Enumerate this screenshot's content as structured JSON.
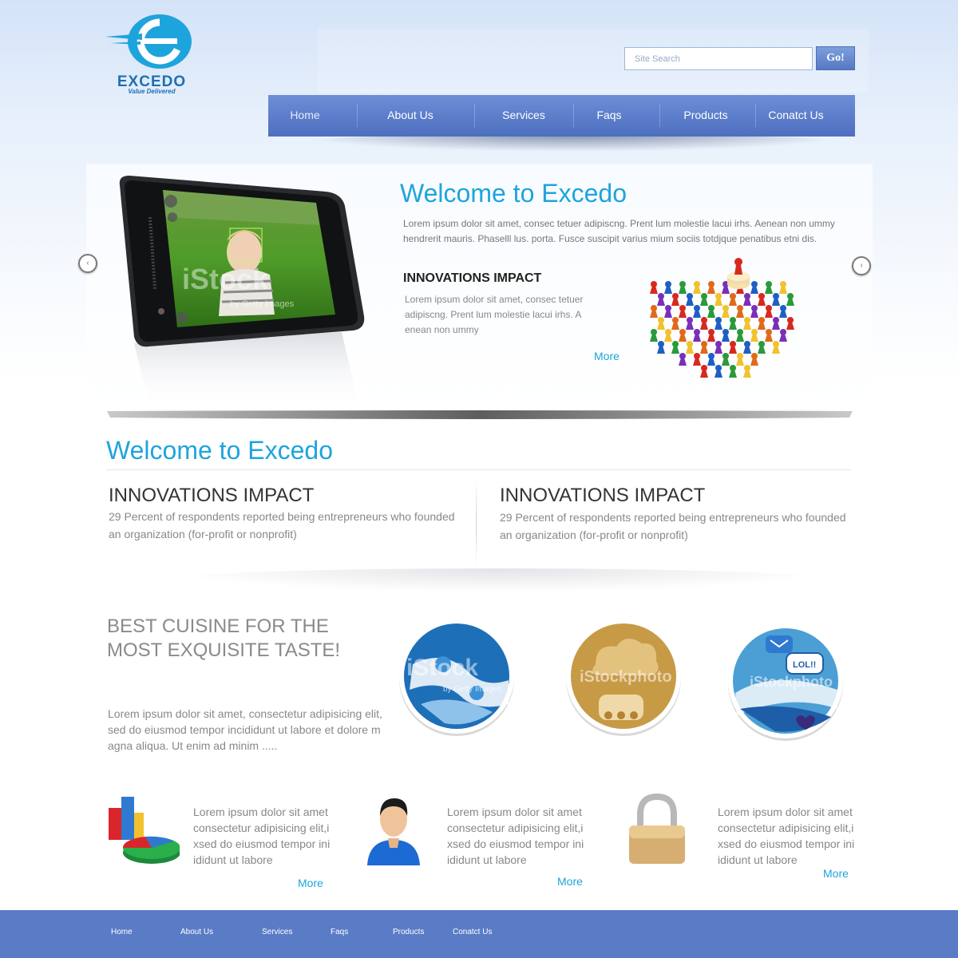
{
  "brand": {
    "name": "EXCEDO",
    "tagline": "Value Delivered",
    "primary_color": "#1ea4dc",
    "nav_color": "#5d7ecb",
    "footer_color": "#5a7cc6"
  },
  "search": {
    "placeholder": "Site Search",
    "button_label": "Go!"
  },
  "nav": {
    "items": [
      {
        "label": "Home",
        "active": true
      },
      {
        "label": "About Us"
      },
      {
        "label": "Services"
      },
      {
        "label": "Faqs"
      },
      {
        "label": "Products"
      },
      {
        "label": "Conatct Us"
      }
    ]
  },
  "slider": {
    "title": "Welcome to Excedo",
    "text": "Lorem ipsum dolor sit amet, consec tetuer adipiscng. Prent lum molestie lacui irhs.  Aenean non ummy hendrerit mauris. Phaselll lus. porta. Fusce suscipit varius mium  sociis totdjque penatibus etni dis.",
    "subhead": "INNOVATIONS IMPACT",
    "subtext": "Lorem ipsum dolor sit amet, consec tetuer adipiscng. Prent lum molestie lacui irhs.  A enean non ummy",
    "more": "More",
    "prev_icon": "chevron-left-icon",
    "next_icon": "chevron-right-icon",
    "image_watermark": "iStock",
    "image_watermark_sub": "by Getty Images"
  },
  "welcome": {
    "title": "Welcome to Excedo",
    "columns": [
      {
        "heading": "INNOVATIONS IMPACT",
        "text": "29 Percent of respondents reported being entrepreneurs who founded an organization (for-profit or nonprofit)"
      },
      {
        "heading": "INNOVATIONS IMPACT",
        "text": "29 Percent of respondents reported being entrepreneurs who founded an organization (for-profit or nonprofit)"
      }
    ]
  },
  "cuisine": {
    "heading": "BEST CUISINE FOR THE MOST EXQUISITE TASTE!",
    "text": "Lorem ipsum dolor sit amet, consectetur adipisicing elit, sed do eiusmod tempor incididunt ut labore et dolore m agna aliqua. Ut enim ad minim .....",
    "circles": [
      {
        "icon": "puzzle-icon",
        "watermark": "iStock",
        "watermark_sub": "by Getty Images"
      },
      {
        "icon": "cloud-icon",
        "watermark": "iStockphoto"
      },
      {
        "icon": "chat-icon",
        "watermark": "iStockphoto",
        "bubble": "LOL!!"
      }
    ]
  },
  "features": [
    {
      "icon": "chart-icon",
      "text": "Lorem ipsum dolor sit amet consectetur adipisicing elit,i xsed do eiusmod tempor ini ididunt ut labore",
      "more": "More"
    },
    {
      "icon": "user-icon",
      "text": "Lorem ipsum dolor sit amet consectetur adipisicing elit,i xsed do eiusmod tempor ini ididunt ut labore",
      "more": "More"
    },
    {
      "icon": "padlock-icon",
      "text": "Lorem ipsum dolor sit amet consectetur adipisicing elit,i xsed do eiusmod tempor ini ididunt ut labore",
      "more": "More"
    }
  ],
  "footer": {
    "items": [
      "Home",
      "About Us",
      "Services",
      "Faqs",
      "Products",
      "Conatct Us"
    ]
  }
}
